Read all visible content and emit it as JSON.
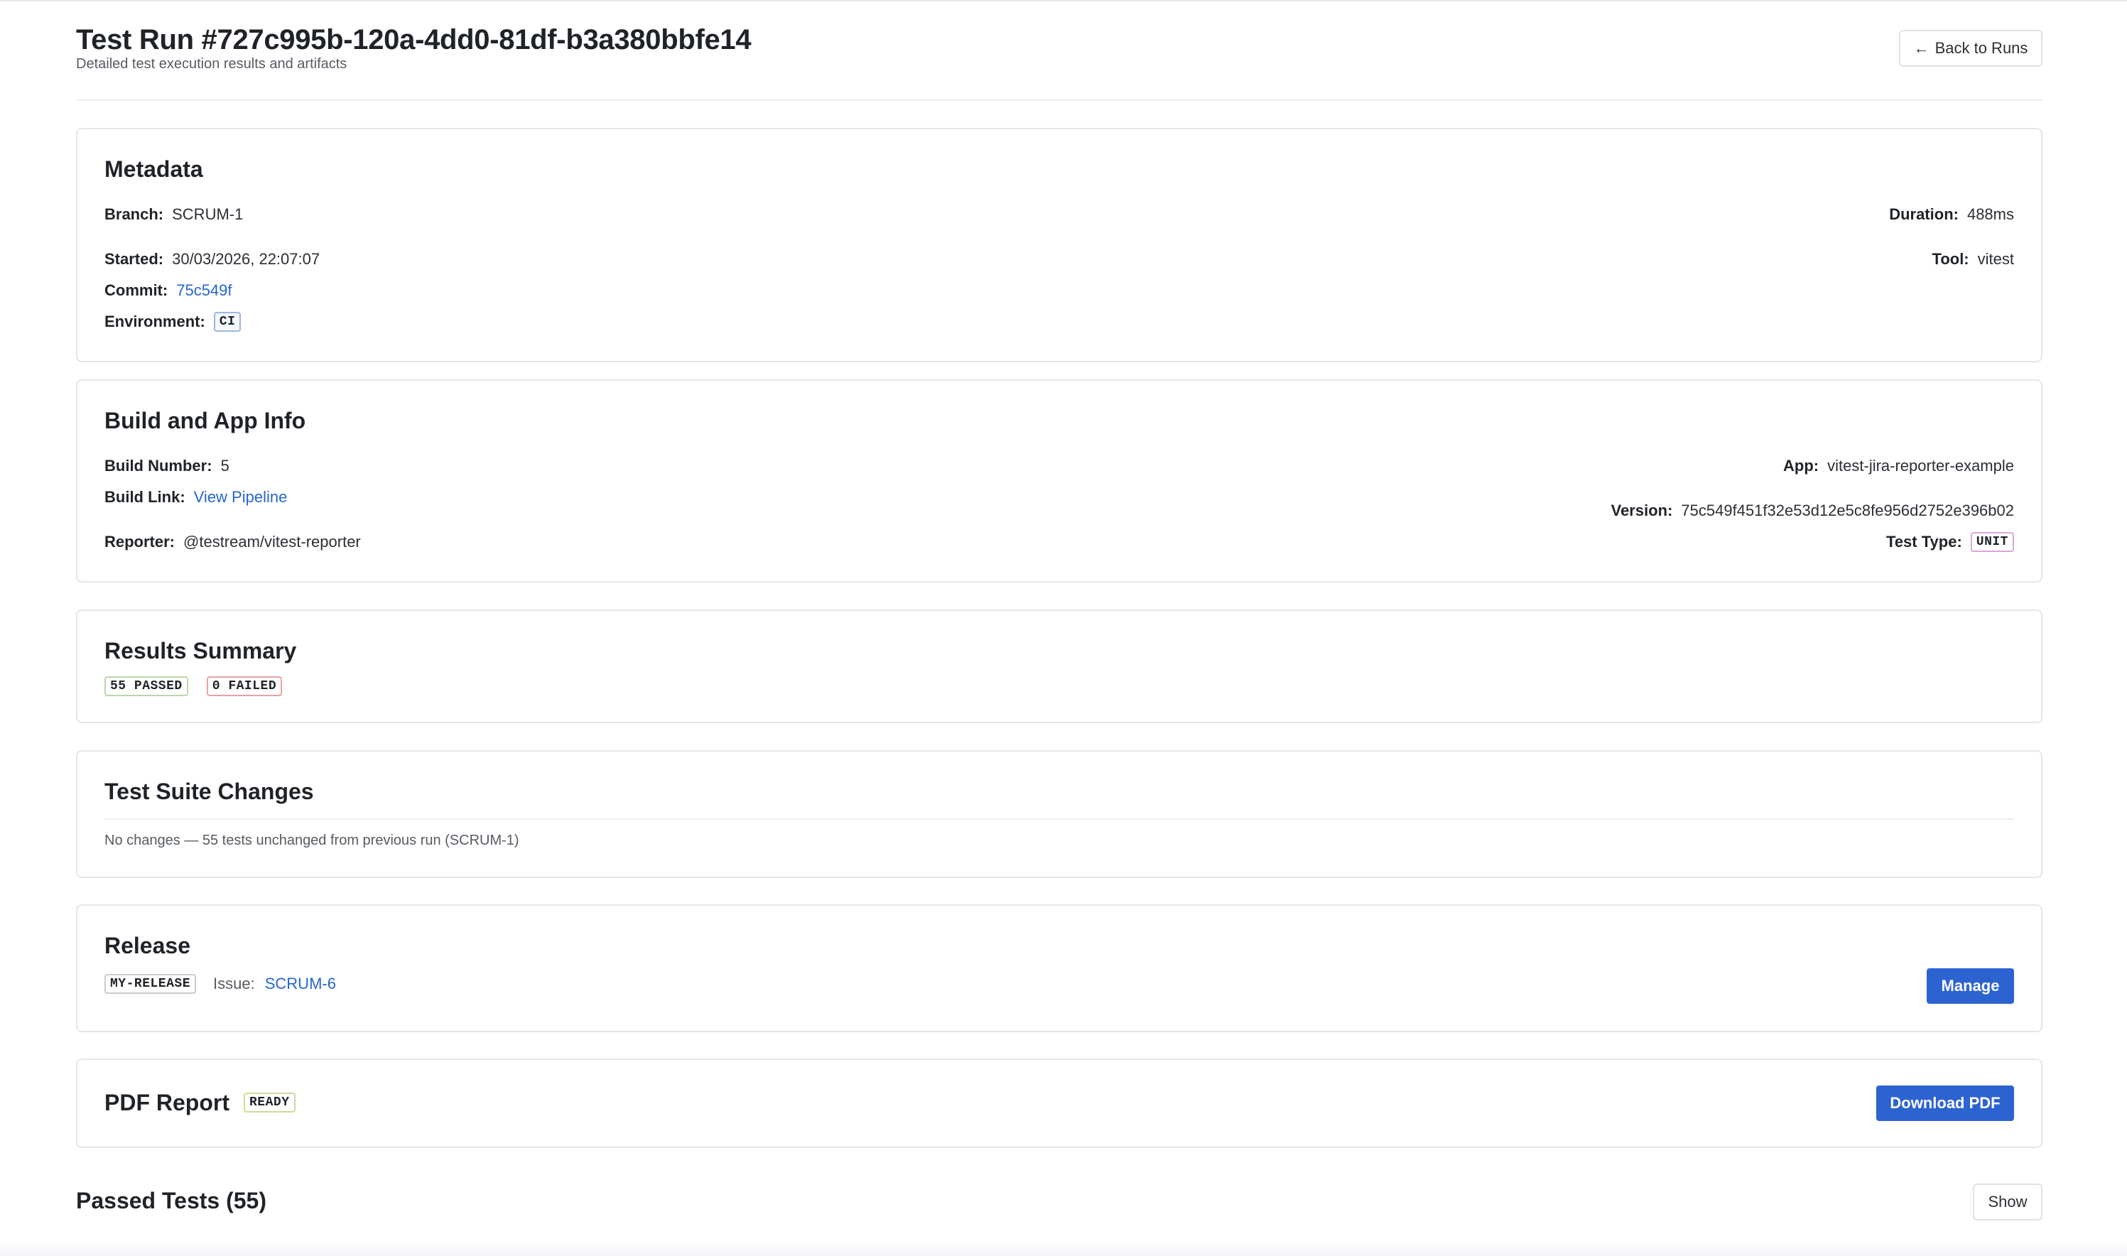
{
  "header": {
    "title": "Test Run #727c995b-120a-4dd0-81df-b3a380bbfe14",
    "subtitle": "Detailed test execution results and artifacts",
    "back_arrow": "←",
    "back_label": "Back to Runs"
  },
  "metadata": {
    "heading": "Metadata",
    "branch_label": "Branch:",
    "branch_value": "SCRUM-1",
    "started_label": "Started:",
    "started_value": "30/03/2026, 22:07:07",
    "commit_label": "Commit:",
    "commit_value": "75c549f",
    "environment_label": "Environment:",
    "environment_value": "CI",
    "duration_label": "Duration:",
    "duration_value": "488ms",
    "tool_label": "Tool:",
    "tool_value": "vitest"
  },
  "build": {
    "heading": "Build and App Info",
    "build_number_label": "Build Number:",
    "build_number_value": "5",
    "build_link_label": "Build Link:",
    "build_link_value": "View Pipeline",
    "reporter_label": "Reporter:",
    "reporter_value": "@testream/vitest-reporter",
    "app_label": "App:",
    "app_value": "vitest-jira-reporter-example",
    "version_label": "Version:",
    "version_value": "75c549f451f32e53d12e5c8fe956d2752e396b02",
    "test_type_label": "Test Type:",
    "test_type_value": "UNIT"
  },
  "summary": {
    "heading": "Results Summary",
    "passed": "55 PASSED",
    "failed": "0 FAILED"
  },
  "changes": {
    "heading": "Test Suite Changes",
    "note": "No changes — 55 tests unchanged from previous run (SCRUM-1)"
  },
  "release": {
    "heading": "Release",
    "name": "MY-RELEASE",
    "issue_label": "Issue:",
    "issue_value": "SCRUM-6",
    "manage_label": "Manage"
  },
  "pdf": {
    "heading": "PDF Report",
    "status": "READY",
    "download_label": "Download PDF"
  },
  "passed_tests": {
    "heading": "Passed Tests (55)",
    "toggle_label": "Show"
  },
  "colors": {
    "accent": "#2d63d0",
    "link": "#2366d1",
    "border": "#e3e6ea"
  }
}
